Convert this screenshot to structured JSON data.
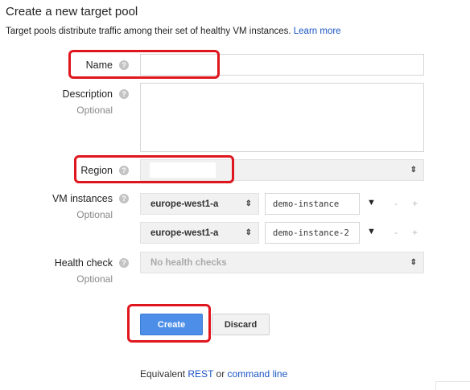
{
  "page": {
    "title": "Create a new target pool",
    "description": "Target pools distribute traffic among their set of healthy VM instances.",
    "learn_more": "Learn more"
  },
  "form": {
    "name": {
      "label": "Name",
      "value": ""
    },
    "description": {
      "label": "Description",
      "optional": "Optional",
      "value": ""
    },
    "region": {
      "label": "Region",
      "value": ""
    },
    "vm_instances": {
      "label": "VM instances",
      "optional": "Optional",
      "rows": [
        {
          "zone": "europe-west1-a",
          "instance": "demo-instance"
        },
        {
          "zone": "europe-west1-a",
          "instance": "demo-instance-2"
        }
      ],
      "remove": "-",
      "add": "+"
    },
    "health_check": {
      "label": "Health check",
      "optional": "Optional",
      "value": "No health checks"
    }
  },
  "buttons": {
    "create": "Create",
    "discard": "Discard"
  },
  "footer": {
    "prefix": "Equivalent",
    "rest": "REST",
    "or": "or",
    "command_line": "command line"
  },
  "colors": {
    "link": "#1a55c4",
    "primary_button": "#4d8ee8",
    "highlight_box": "#e0161e"
  },
  "icons": {
    "help": "help-circle-icon",
    "select_arrows": "select-arrows-icon",
    "dropdown": "triangle-down-icon"
  }
}
